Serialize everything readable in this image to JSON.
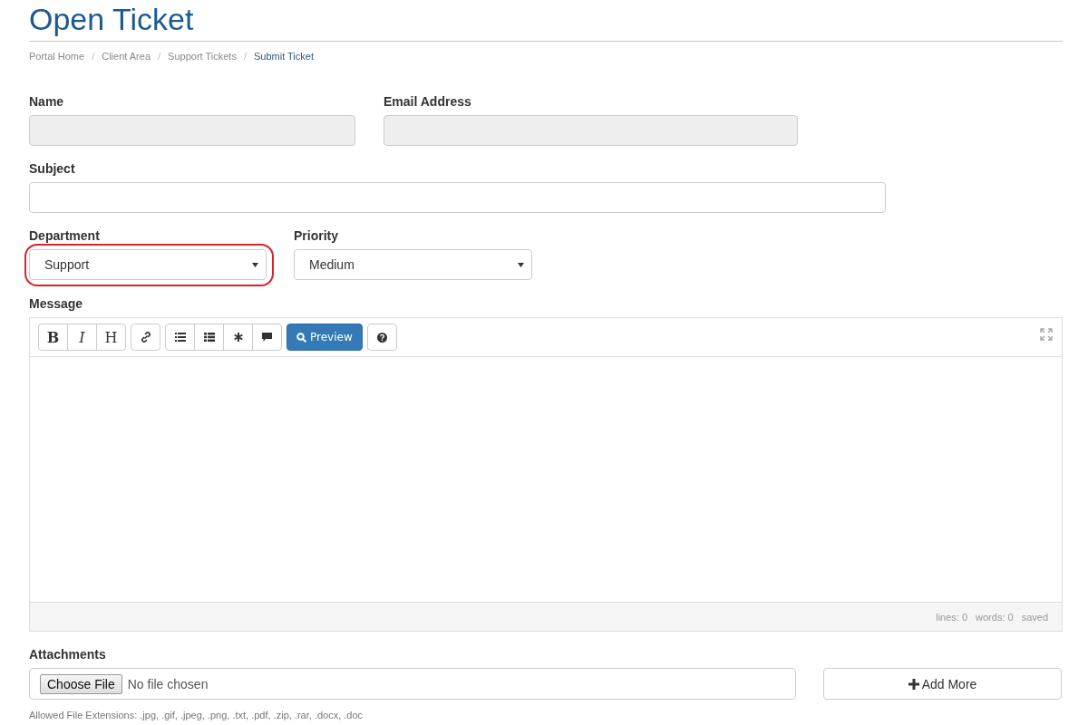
{
  "page_title": "Open Ticket",
  "breadcrumb_separator": "/",
  "breadcrumb": [
    {
      "label": "Portal Home",
      "current": false
    },
    {
      "label": "Client Area",
      "current": false
    },
    {
      "label": "Support Tickets",
      "current": false
    },
    {
      "label": "Submit Ticket",
      "current": true
    }
  ],
  "name": {
    "label": "Name",
    "disabled": true
  },
  "email": {
    "label": "Email Address",
    "disabled": true
  },
  "subject": {
    "label": "Subject"
  },
  "department": {
    "label": "Department",
    "value": "Support",
    "highlighted": true
  },
  "priority": {
    "label": "Priority",
    "value": "Medium",
    "highlighted": false
  },
  "message": {
    "label": "Message",
    "toolbar": [
      [
        {
          "kind": "bold",
          "label": "B"
        },
        {
          "kind": "italic",
          "label": "I"
        },
        {
          "kind": "heading",
          "label": "H"
        }
      ],
      [
        {
          "kind": "link"
        }
      ],
      [
        {
          "kind": "bullet-list"
        },
        {
          "kind": "numbered-list"
        },
        {
          "kind": "asterisk"
        },
        {
          "kind": "comment"
        }
      ],
      [
        {
          "kind": "preview",
          "label": "Preview"
        }
      ],
      [
        {
          "kind": "help"
        }
      ]
    ],
    "status": [
      "lines: 0",
      "words: 0",
      "saved"
    ]
  },
  "attachments": {
    "label": "Attachments",
    "choose_button": "Choose File",
    "file_status": "No file chosen",
    "add_more": "Add More",
    "help": "Allowed File Extensions: .jpg, .gif, .jpeg, .png, .txt, .pdf, .zip, .rar, .docx, .doc"
  }
}
